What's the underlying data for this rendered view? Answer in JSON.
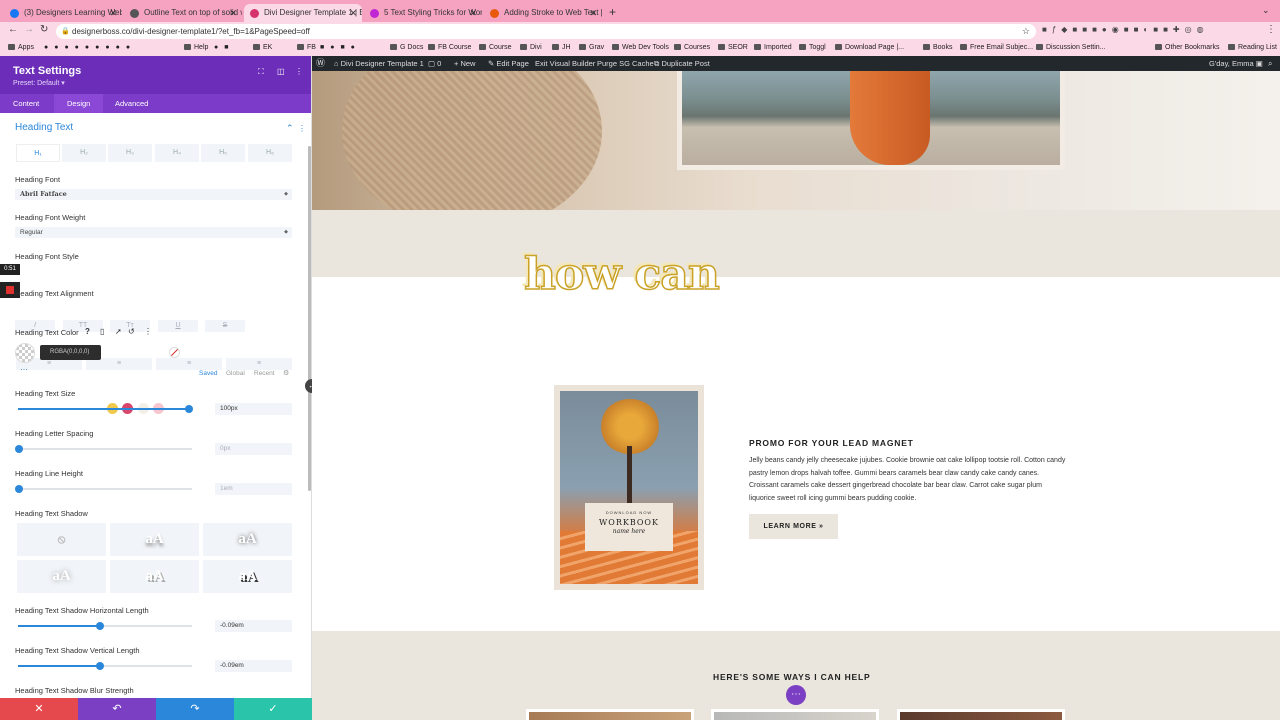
{
  "browser": {
    "tabs": [
      {
        "title": "(3) Designers Learning Web De...",
        "fav": "#1877f2"
      },
      {
        "title": "Outline Text on top of solid wh...",
        "fav": "#555"
      },
      {
        "title": "Divi Designer Template 1 | By A...",
        "fav": "#d6336c"
      },
      {
        "title": "5 Text Styling Tricks for WordP...",
        "fav": "#c026d3"
      },
      {
        "title": "Adding Stroke to Web Text | C...",
        "fav": "#e8590c"
      }
    ],
    "url": "designerboss.co/divi-designer-template1/?et_fb=1&PageSpeed=off",
    "bookmarks": [
      "Apps",
      "",
      "",
      "",
      "",
      "",
      "",
      "",
      "",
      "Help",
      "",
      "",
      "EK",
      "FB",
      "",
      "",
      "",
      "G Docs",
      "FB Course",
      "Course",
      "Divi",
      "JH",
      "Grav",
      "Web Dev Tools",
      "Courses",
      "SEOR",
      "Imported",
      "Toggl",
      "Download Page |...",
      "Books",
      "Free Email Subjec...",
      "Discussion Settin...",
      "",
      "Other Bookmarks",
      "Reading List"
    ]
  },
  "wpbar": {
    "site": "Divi Designer Template 1",
    "comments": "0",
    "new": "New",
    "edit": "Edit Page",
    "exit": "Exit Visual Builder",
    "purge": "Purge SG Cache",
    "duplicate": "Duplicate Post",
    "greeting": "G'day, Emma"
  },
  "panel": {
    "title": "Text Settings",
    "preset": "Preset: Default ▾",
    "tabs": [
      "Content",
      "Design",
      "Advanced"
    ],
    "section": "Heading Text",
    "heading_levels": [
      "H₁",
      "H₂",
      "H₃",
      "H₄",
      "H₅",
      "H₆"
    ],
    "font_label": "Heading Font",
    "font_value": "Abril Fatface",
    "weight_label": "Heading Font Weight",
    "weight_value": "Regular",
    "style_label": "Heading Font Style",
    "style_buttons": [
      "I",
      "TT",
      "Tт",
      "U",
      "S"
    ],
    "timer": "0:51",
    "align_label": "Heading Text Alignment",
    "align_buttons": [
      "≡",
      "≡",
      "≡",
      "≡"
    ],
    "color_label": "Heading Text Color",
    "color_tooltip": "RGBA(0,0,0,0)",
    "swatches": [
      "#f0c94a",
      "#d6476b",
      "#f2efe6",
      "#f7c6cf"
    ],
    "color_tabs": [
      "Saved",
      "Global",
      "Recent"
    ],
    "size_label": "Heading Text Size",
    "size_value": "100px",
    "size_level": 0.98,
    "spacing_label": "Heading Letter Spacing",
    "spacing_value": "0px",
    "lineheight_label": "Heading Line Height",
    "lineheight_value": "1em",
    "shadow_label": "Heading Text Shadow",
    "shadow_option": "aA",
    "hlen_label": "Heading Text Shadow Horizontal Length",
    "hlen_value": "-0.09em",
    "hlen_level": 0.47,
    "vlen_label": "Heading Text Shadow Vertical Length",
    "vlen_value": "-0.09em",
    "vlen_level": 0.47,
    "blur_label": "Heading Text Shadow Blur Strength",
    "footer_colors": [
      "#e5484d",
      "#7b3fc4",
      "#2b87da",
      "#29c4a9"
    ]
  },
  "content": {
    "heading": "how can",
    "promo_title": "PROMO FOR YOUR LEAD MAGNET",
    "promo_body": "Jelly beans candy jelly cheesecake jujubes. Cookie brownie oat cake lollipop tootsie roll. Cotton candy pastry lemon drops halvah toffee. Gummi bears caramels bear claw candy cake candy canes. Croissant caramels cake dessert gingerbread chocolate bar bear claw. Carrot cake sugar plum liquorice sweet roll icing gummi bears pudding cookie.",
    "learn_more": "LEARN MORE »",
    "book_small": "DOWNLOAD NOW",
    "book_title": "WORKBOOK",
    "book_sub": "name here",
    "help_title": "HERE'S SOME WAYS I CAN HELP"
  }
}
